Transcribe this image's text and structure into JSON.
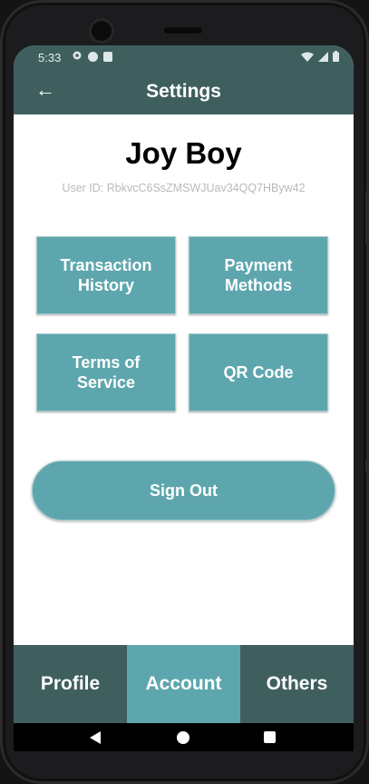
{
  "status_bar": {
    "time": "5:33",
    "left_icons": [
      "gear-icon",
      "android-icon",
      "sd-card-icon"
    ],
    "right_icons": [
      "wifi-icon",
      "signal-icon",
      "battery-icon"
    ]
  },
  "app_bar": {
    "back_icon": "←",
    "title": "Settings"
  },
  "profile": {
    "name": "Joy Boy",
    "user_id": "User ID: RbkvcC6SsZMSWJUav34QQ7HByw42"
  },
  "tiles": [
    {
      "label": "Transaction History"
    },
    {
      "label": "Payment Methods"
    },
    {
      "label": "Terms of Service"
    },
    {
      "label": "QR Code"
    }
  ],
  "sign_out_label": "Sign Out",
  "bottom_nav": {
    "active_index": 1,
    "tabs": [
      {
        "label": "Profile"
      },
      {
        "label": "Account"
      },
      {
        "label": "Others"
      }
    ]
  },
  "colors": {
    "appbar": "#3f5f5f",
    "accent": "#5ea6ad",
    "background": "#ffffff"
  }
}
